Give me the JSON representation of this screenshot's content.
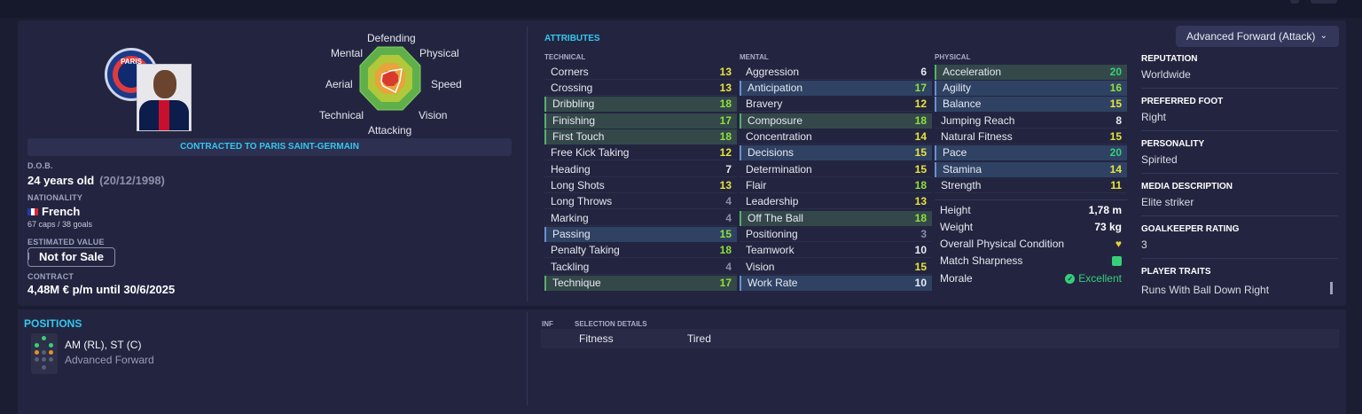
{
  "player": {
    "club_badge_text": "PARIS",
    "contracted": "CONTRACTED TO PARIS SAINT-GERMAIN",
    "dob_label": "D.O.B.",
    "age": "24 years old",
    "dob": "(20/12/1998)",
    "nationality_label": "NATIONALITY",
    "nationality": "French",
    "caps": "67 caps / 38 goals",
    "value_label": "ESTIMATED VALUE",
    "value": "Not for Sale",
    "contract_label": "CONTRACT",
    "contract": "4,48M € p/m until 30/6/2025"
  },
  "radar": {
    "labels": [
      "Defending",
      "Physical",
      "Speed",
      "Vision",
      "Attacking",
      "Technical",
      "Aerial",
      "Mental"
    ]
  },
  "attributes": {
    "title": "ATTRIBUTES",
    "technical_head": "TECHNICAL",
    "mental_head": "MENTAL",
    "physical_head": "PHYSICAL",
    "technical": [
      {
        "name": "Corners",
        "value": "13"
      },
      {
        "name": "Crossing",
        "value": "13"
      },
      {
        "name": "Dribbling",
        "value": "18"
      },
      {
        "name": "Finishing",
        "value": "17"
      },
      {
        "name": "First Touch",
        "value": "18"
      },
      {
        "name": "Free Kick Taking",
        "value": "12"
      },
      {
        "name": "Heading",
        "value": "7"
      },
      {
        "name": "Long Shots",
        "value": "13"
      },
      {
        "name": "Long Throws",
        "value": "4"
      },
      {
        "name": "Marking",
        "value": "4"
      },
      {
        "name": "Passing",
        "value": "15"
      },
      {
        "name": "Penalty Taking",
        "value": "18"
      },
      {
        "name": "Tackling",
        "value": "4"
      },
      {
        "name": "Technique",
        "value": "17"
      }
    ],
    "mental": [
      {
        "name": "Aggression",
        "value": "6"
      },
      {
        "name": "Anticipation",
        "value": "17"
      },
      {
        "name": "Bravery",
        "value": "12"
      },
      {
        "name": "Composure",
        "value": "18"
      },
      {
        "name": "Concentration",
        "value": "14"
      },
      {
        "name": "Decisions",
        "value": "15"
      },
      {
        "name": "Determination",
        "value": "15"
      },
      {
        "name": "Flair",
        "value": "18"
      },
      {
        "name": "Leadership",
        "value": "13"
      },
      {
        "name": "Off The Ball",
        "value": "18"
      },
      {
        "name": "Positioning",
        "value": "3"
      },
      {
        "name": "Teamwork",
        "value": "10"
      },
      {
        "name": "Vision",
        "value": "15"
      },
      {
        "name": "Work Rate",
        "value": "10"
      }
    ],
    "physical": [
      {
        "name": "Acceleration",
        "value": "20"
      },
      {
        "name": "Agility",
        "value": "16"
      },
      {
        "name": "Balance",
        "value": "15"
      },
      {
        "name": "Jumping Reach",
        "value": "8"
      },
      {
        "name": "Natural Fitness",
        "value": "15"
      },
      {
        "name": "Pace",
        "value": "20"
      },
      {
        "name": "Stamina",
        "value": "14"
      },
      {
        "name": "Strength",
        "value": "11"
      }
    ],
    "height_label": "Height",
    "height": "1,78 m",
    "weight_label": "Weight",
    "weight": "73 kg",
    "condition_label": "Overall Physical Condition",
    "sharpness_label": "Match Sharpness",
    "morale_label": "Morale",
    "morale": "Excellent"
  },
  "role_dropdown": "Advanced Forward (Attack)",
  "info": {
    "reputation_label": "REPUTATION",
    "reputation": "Worldwide",
    "foot_label": "PREFERRED FOOT",
    "foot": "Right",
    "personality_label": "PERSONALITY",
    "personality": "Spirited",
    "media_label": "MEDIA DESCRIPTION",
    "media": "Elite striker",
    "gk_label": "GOALKEEPER RATING",
    "gk": "3",
    "traits_label": "PLAYER TRAITS",
    "traits": "Runs With Ball Down Right"
  },
  "positions": {
    "title": "POSITIONS",
    "positions": "AM (RL), ST (C)",
    "role": "Advanced Forward"
  },
  "selection": {
    "inf_head": "INF",
    "details_head": "SELECTION DETAILS",
    "key": "Fitness",
    "value": "Tired"
  },
  "colors": {
    "accent": "#35c7f0",
    "background": "#1b1d33",
    "panel": "#232540",
    "green_high": "#36d07a",
    "lime": "#8fe03b",
    "yellow": "#e8e43a"
  }
}
